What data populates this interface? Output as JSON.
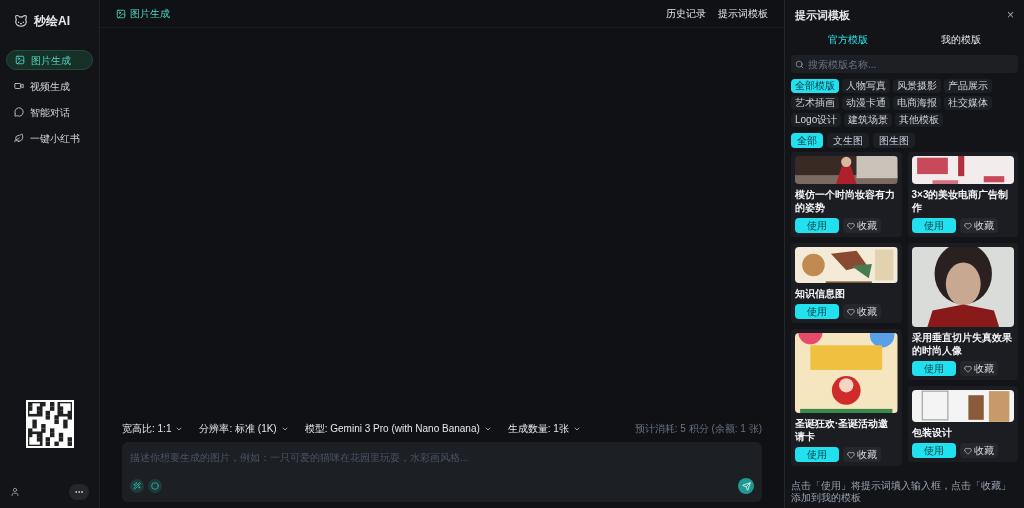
{
  "app": {
    "name": "秒绘AI"
  },
  "sidebar": {
    "items": [
      {
        "label": "图片生成",
        "selected": true
      },
      {
        "label": "视频生成",
        "selected": false
      },
      {
        "label": "智能对话",
        "selected": false
      },
      {
        "label": "一键小红书",
        "selected": false
      }
    ]
  },
  "header": {
    "title": "图片生成",
    "links": [
      "历史记录",
      "提示词模板"
    ]
  },
  "toolbar": {
    "options": [
      "宽高比: 1:1",
      "分辨率: 标准 (1K)",
      "模型: Gemini 3 Pro (with Nano Banana)",
      "生成数量: 1张"
    ],
    "cost": "预计消耗: 5 积分 (余额: 1 张)"
  },
  "prompt": {
    "placeholder": "描述你想要生成的图片，例如：一只可爱的猫咪在花园里玩耍，水彩画风格..."
  },
  "panel": {
    "title": "提示词模板",
    "close": "×",
    "tabs": [
      {
        "label": "官方模版",
        "selected": true
      },
      {
        "label": "我的模版",
        "selected": false
      }
    ],
    "search": {
      "placeholder": "搜索模版名称..."
    },
    "categories": [
      {
        "label": "全部模版",
        "selected": true
      },
      {
        "label": "人物写真",
        "selected": false
      },
      {
        "label": "风景摄影",
        "selected": false
      },
      {
        "label": "产品展示",
        "selected": false
      },
      {
        "label": "艺术插画",
        "selected": false
      },
      {
        "label": "动漫卡通",
        "selected": false
      },
      {
        "label": "电商海报",
        "selected": false
      },
      {
        "label": "社交媒体",
        "selected": false
      },
      {
        "label": "Logo设计",
        "selected": false
      },
      {
        "label": "建筑场景",
        "selected": false
      },
      {
        "label": "其他模板",
        "selected": false
      }
    ],
    "filters": [
      {
        "label": "全部",
        "selected": true
      },
      {
        "label": "文生图",
        "selected": false
      },
      {
        "label": "图生图",
        "selected": false
      }
    ],
    "cards": [
      {
        "title": "模仿一个时尚妆容有力的姿势",
        "use": "使用",
        "favorite": "收藏"
      },
      {
        "title": "知识信息图",
        "use": "使用",
        "favorite": "收藏"
      },
      {
        "title": "圣诞狂欢·圣诞活动邀请卡",
        "use": "使用",
        "favorite": "收藏"
      },
      {
        "title": "3×3的美妆电商广告制作",
        "use": "使用",
        "favorite": "收藏"
      },
      {
        "title": "采用垂直切片失真效果的时尚人像",
        "use": "使用",
        "favorite": "收藏"
      },
      {
        "title": "包装设计",
        "use": "使用",
        "favorite": "收藏"
      }
    ],
    "hint": "点击「使用」将提示词填入输入框，点击「收藏」添加到我的模板"
  }
}
